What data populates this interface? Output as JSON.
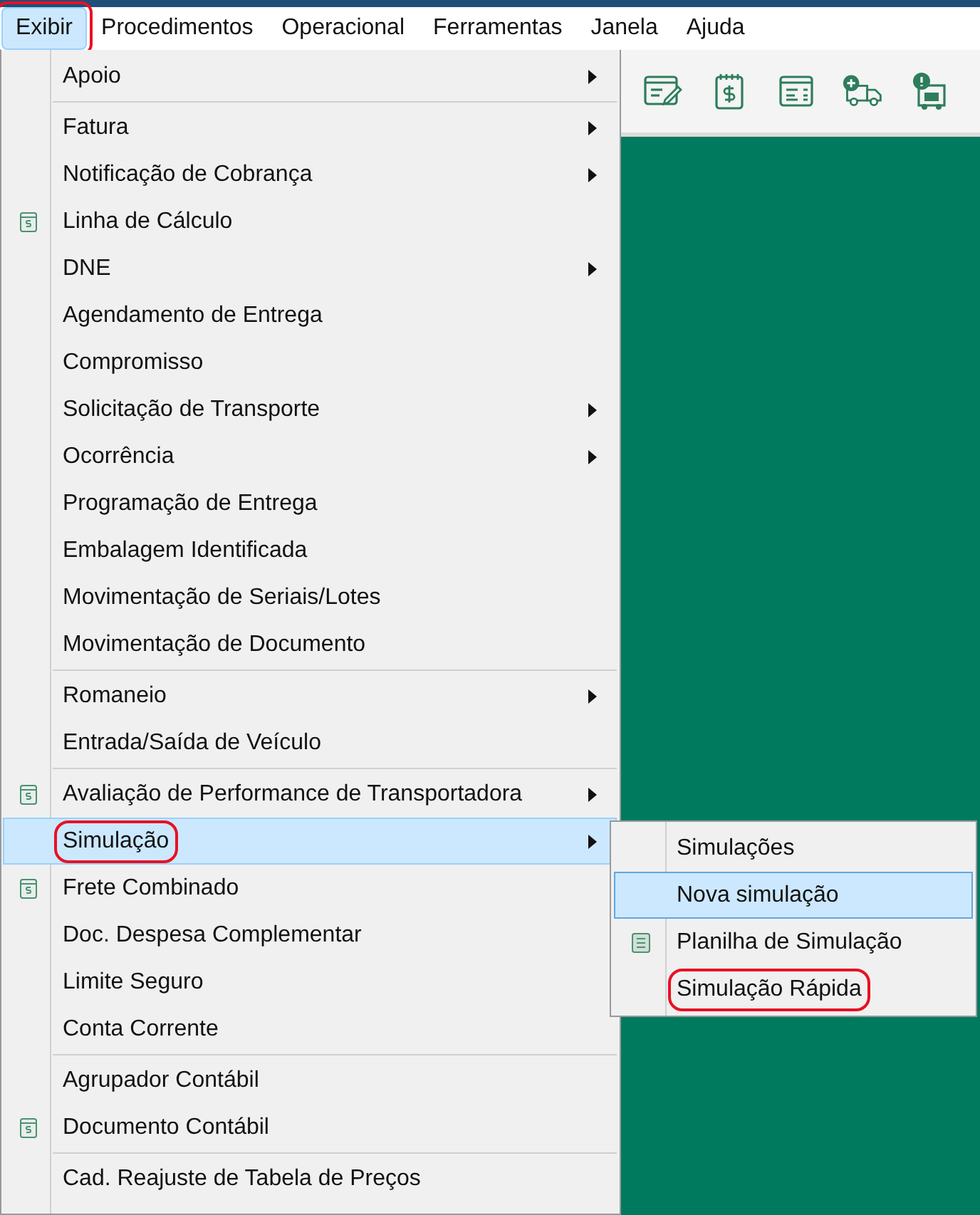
{
  "menubar": [
    {
      "label": "Exibir",
      "selected": true,
      "highlighted": true
    },
    {
      "label": "Procedimentos",
      "selected": false,
      "highlighted": false
    },
    {
      "label": "Operacional",
      "selected": false,
      "highlighted": false
    },
    {
      "label": "Ferramentas",
      "selected": false,
      "highlighted": false
    },
    {
      "label": "Janela",
      "selected": false,
      "highlighted": false
    },
    {
      "label": "Ajuda",
      "selected": false,
      "highlighted": false
    }
  ],
  "menu": {
    "items": [
      {
        "kind": "item",
        "label": "Apoio",
        "has_icon": false,
        "has_submenu": true,
        "selected": false,
        "highlighted": false
      },
      {
        "kind": "separator"
      },
      {
        "kind": "item",
        "label": "Fatura",
        "has_icon": false,
        "has_submenu": true,
        "selected": false,
        "highlighted": false
      },
      {
        "kind": "item",
        "label": "Notificação de Cobrança",
        "has_icon": false,
        "has_submenu": true,
        "selected": false,
        "highlighted": false
      },
      {
        "kind": "item",
        "label": "Linha de Cálculo",
        "has_icon": true,
        "has_submenu": false,
        "selected": false,
        "highlighted": false
      },
      {
        "kind": "item",
        "label": "DNE",
        "has_icon": false,
        "has_submenu": true,
        "selected": false,
        "highlighted": false
      },
      {
        "kind": "item",
        "label": "Agendamento de Entrega",
        "has_icon": false,
        "has_submenu": false,
        "selected": false,
        "highlighted": false
      },
      {
        "kind": "item",
        "label": "Compromisso",
        "has_icon": false,
        "has_submenu": false,
        "selected": false,
        "highlighted": false
      },
      {
        "kind": "item",
        "label": "Solicitação de Transporte",
        "has_icon": false,
        "has_submenu": true,
        "selected": false,
        "highlighted": false
      },
      {
        "kind": "item",
        "label": "Ocorrência",
        "has_icon": false,
        "has_submenu": true,
        "selected": false,
        "highlighted": false
      },
      {
        "kind": "item",
        "label": "Programação de Entrega",
        "has_icon": false,
        "has_submenu": false,
        "selected": false,
        "highlighted": false
      },
      {
        "kind": "item",
        "label": "Embalagem Identificada",
        "has_icon": false,
        "has_submenu": false,
        "selected": false,
        "highlighted": false
      },
      {
        "kind": "item",
        "label": "Movimentação de Seriais/Lotes",
        "has_icon": false,
        "has_submenu": false,
        "selected": false,
        "highlighted": false
      },
      {
        "kind": "item",
        "label": "Movimentação de Documento",
        "has_icon": false,
        "has_submenu": false,
        "selected": false,
        "highlighted": false
      },
      {
        "kind": "separator"
      },
      {
        "kind": "item",
        "label": "Romaneio",
        "has_icon": false,
        "has_submenu": true,
        "selected": false,
        "highlighted": false
      },
      {
        "kind": "item",
        "label": "Entrada/Saída de Veículo",
        "has_icon": false,
        "has_submenu": false,
        "selected": false,
        "highlighted": false
      },
      {
        "kind": "separator"
      },
      {
        "kind": "item",
        "label": "Avaliação de Performance de Transportadora",
        "has_icon": true,
        "has_submenu": true,
        "selected": false,
        "highlighted": false
      },
      {
        "kind": "item",
        "label": "Simulação",
        "has_icon": false,
        "has_submenu": true,
        "selected": true,
        "highlighted": true
      },
      {
        "kind": "item",
        "label": "Frete Combinado",
        "has_icon": true,
        "has_submenu": false,
        "selected": false,
        "highlighted": false
      },
      {
        "kind": "item",
        "label": "Doc. Despesa Complementar",
        "has_icon": false,
        "has_submenu": false,
        "selected": false,
        "highlighted": false
      },
      {
        "kind": "item",
        "label": "Limite Seguro",
        "has_icon": false,
        "has_submenu": false,
        "selected": false,
        "highlighted": false
      },
      {
        "kind": "item",
        "label": "Conta Corrente",
        "has_icon": false,
        "has_submenu": false,
        "selected": false,
        "highlighted": false
      },
      {
        "kind": "separator"
      },
      {
        "kind": "item",
        "label": "Agrupador Contábil",
        "has_icon": false,
        "has_submenu": false,
        "selected": false,
        "highlighted": false
      },
      {
        "kind": "item",
        "label": "Documento Contábil",
        "has_icon": true,
        "has_submenu": false,
        "selected": false,
        "highlighted": false
      },
      {
        "kind": "separator"
      },
      {
        "kind": "item",
        "label": "Cad. Reajuste de Tabela de Preços",
        "has_icon": false,
        "has_submenu": false,
        "selected": false,
        "highlighted": false
      }
    ]
  },
  "submenu": {
    "items": [
      {
        "label": "Simulações",
        "has_icon": false,
        "selected": false,
        "highlighted": false
      },
      {
        "label": "Nova simulação",
        "has_icon": false,
        "selected": true,
        "highlighted": false
      },
      {
        "label": "Planilha de Simulação",
        "has_icon": true,
        "selected": false,
        "highlighted": false
      },
      {
        "label": "Simulação Rápida",
        "has_icon": false,
        "selected": false,
        "highlighted": true
      }
    ]
  }
}
